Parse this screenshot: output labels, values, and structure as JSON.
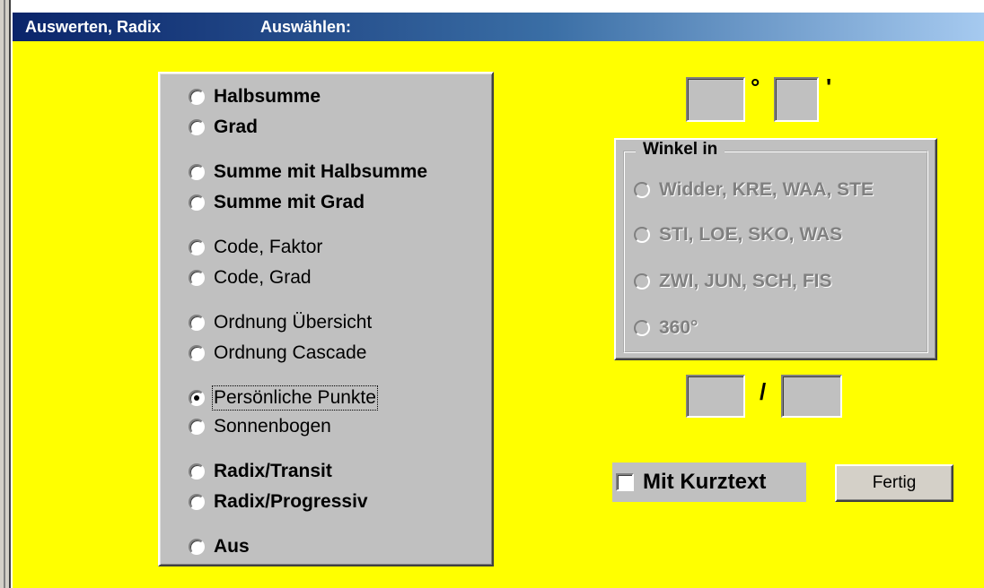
{
  "title": {
    "left": "Auswerten, Radix",
    "right": "Auswählen:"
  },
  "options": [
    {
      "label": "Halbsumme",
      "bold": true,
      "checked": false
    },
    {
      "label": "Grad",
      "bold": true,
      "checked": false
    },
    {
      "label": "Summe mit Halbsumme",
      "bold": true,
      "checked": false
    },
    {
      "label": "Summe mit Grad",
      "bold": true,
      "checked": false
    },
    {
      "label": "Code, Faktor",
      "bold": false,
      "checked": false
    },
    {
      "label": "Code, Grad",
      "bold": false,
      "checked": false
    },
    {
      "label": "Ordnung Übersicht",
      "bold": false,
      "checked": false
    },
    {
      "label": "Ordnung Cascade",
      "bold": false,
      "checked": false
    },
    {
      "label": "Persönliche Punkte",
      "bold": false,
      "checked": true
    },
    {
      "label": "Sonnenbogen",
      "bold": false,
      "checked": false
    },
    {
      "label": "Radix/Transit",
      "bold": true,
      "checked": false
    },
    {
      "label": "Radix/Progressiv",
      "bold": true,
      "checked": false
    },
    {
      "label": "Aus",
      "bold": true,
      "checked": false
    }
  ],
  "angle": {
    "degree_symbol": "°",
    "minute_symbol": "'",
    "degree_value": "",
    "minute_value": ""
  },
  "winkel": {
    "legend": "Winkel in",
    "options": [
      "Widder, KRE, WAA, STE",
      "STI, LOE, SKO, WAS",
      "ZWI, JUN, SCH, FIS",
      "360°"
    ]
  },
  "ratio": {
    "separator": "/",
    "left_value": "",
    "right_value": ""
  },
  "checkbox": {
    "label": "Mit Kurztext",
    "checked": false
  },
  "button": {
    "label": "Fertig"
  },
  "colors": {
    "background": "#ffff00",
    "panel": "#c0c0c0",
    "title_start": "#0a246a",
    "title_end": "#a6caf0"
  }
}
